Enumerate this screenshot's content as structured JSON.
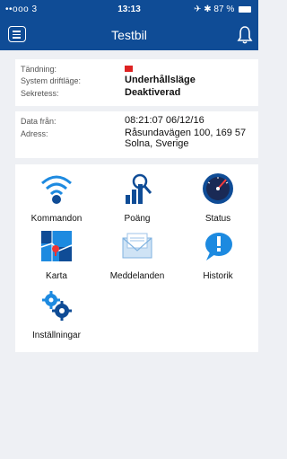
{
  "status_bar": {
    "signal": "••ooo 3",
    "time": "13:13",
    "battery": "87 %"
  },
  "nav": {
    "title": "Testbil"
  },
  "info": {
    "ignition_label": "Tändning:",
    "mode_label": "System driftläge:",
    "mode_value": "Underhållsläge",
    "privacy_label": "Sekretess:",
    "privacy_value": "Deaktiverad"
  },
  "location": {
    "data_from_label": "Data från:",
    "data_from_value": "08:21:07 06/12/16",
    "address_label": "Adress:",
    "address_line1": "Råsundavägen 100, 169 57",
    "address_line2": "Solna, Sverige"
  },
  "menu": {
    "items": [
      {
        "label": "Kommandon",
        "icon": "wifi-icon"
      },
      {
        "label": "Poäng",
        "icon": "score-icon"
      },
      {
        "label": "Status",
        "icon": "gauge-icon"
      },
      {
        "label": "Karta",
        "icon": "map-icon"
      },
      {
        "label": "Meddelanden",
        "icon": "envelope-icon"
      },
      {
        "label": "Historik",
        "icon": "speech-bubble-icon"
      },
      {
        "label": "Inställningar",
        "icon": "gears-icon"
      }
    ]
  },
  "colors": {
    "bar": "#0f4c96",
    "accent": "#1d8ae0",
    "alert": "#d22"
  }
}
